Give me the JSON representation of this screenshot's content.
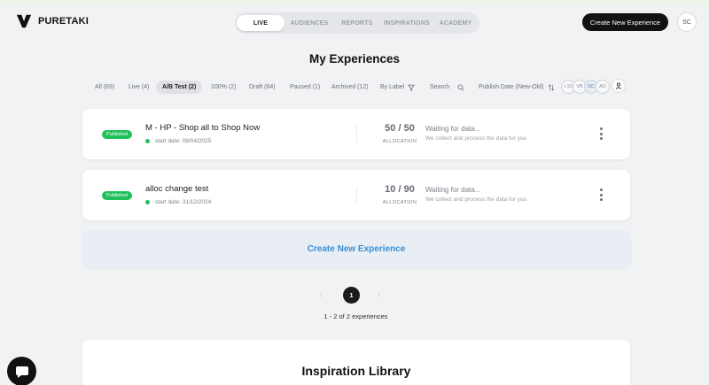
{
  "brand": {
    "name": "PURETAKI"
  },
  "nav": {
    "items": [
      "LIVE",
      "AUDIENCES",
      "REPORTS",
      "INSPIRATIONS",
      "ACADEMY"
    ],
    "active": "LIVE"
  },
  "header": {
    "create_button": "Create New Experience",
    "user_initials": "SC"
  },
  "page": {
    "title": "My Experiences"
  },
  "filters": {
    "tabs": [
      "All (69)",
      "Live (4)",
      "A/B Test (2)",
      "100% (2)",
      "Draft (64)",
      "Paused (1)",
      "Archived (12)"
    ],
    "active_tab": "A/B Test (2)",
    "by_label": "By Label",
    "search": "Search",
    "sort": "Publish Date (New-Old)",
    "avatars": [
      "+10",
      "VB",
      "SC",
      "AD"
    ]
  },
  "experiences": [
    {
      "status": "Published",
      "name": "M - HP - Shop all to Shop Now",
      "start_date": "start date: 08/04/2025",
      "allocation": "50 / 50",
      "allocation_label": "ALLOCATION",
      "status_main": "Waiting for data...",
      "status_sub": "We collect and process the data for you"
    },
    {
      "status": "Published",
      "name": "alloc change test",
      "start_date": "start date: 31/12/2024",
      "allocation": "10 / 90",
      "allocation_label": "ALLOCATION",
      "status_main": "Waiting for data...",
      "status_sub": "We collect and process the data for you"
    }
  ],
  "create_card": {
    "label": "Create New Experience"
  },
  "pagination": {
    "current": "1",
    "summary": "1 - 2 of 2 experiences",
    "prev": "‹",
    "next": "›"
  },
  "inspiration": {
    "title": "Inspiration Library"
  },
  "colors": {
    "published": "#20c15a",
    "accent": "#3a8fd6",
    "dark": "#121212"
  }
}
